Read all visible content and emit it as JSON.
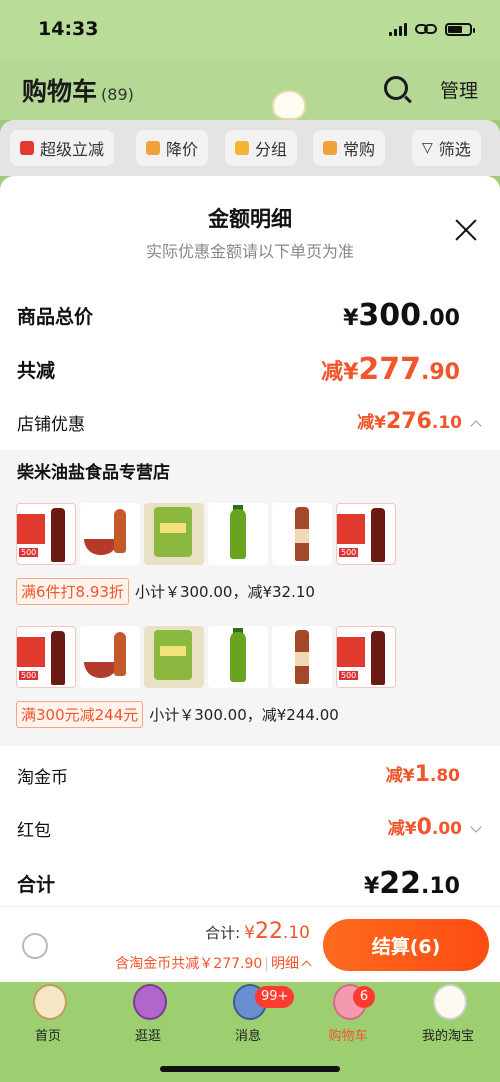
{
  "status": {
    "time": "14:33"
  },
  "header": {
    "title": "购物车",
    "count": "(89)",
    "manage": "管理"
  },
  "filters": [
    {
      "label": "超级立减",
      "icon": "arrow-down-icon"
    },
    {
      "label": "降价",
      "icon": "price-drop-icon"
    },
    {
      "label": "分组",
      "icon": "folder-icon"
    },
    {
      "label": "常购",
      "icon": "cart-icon"
    },
    {
      "label": "筛选",
      "icon": "filter-icon"
    }
  ],
  "sheet": {
    "title": "金额明细",
    "subtitle": "实际优惠金额请以下单页为准",
    "total_label": "商品总价",
    "total_currency": "¥",
    "total_int": "300",
    "total_dec": ".00",
    "discount_label": "共减",
    "discount_prefix": "减¥",
    "discount_int": "277",
    "discount_dec": ".90",
    "shop_label": "店铺优惠",
    "shop_prefix": "减¥",
    "shop_int": "276",
    "shop_dec": ".10",
    "store_name": "柴米油盐食品专营店",
    "promos": [
      {
        "tag": "满6件打8.93折",
        "text": "小计￥300.00，减¥32.10"
      },
      {
        "tag": "满300元减244元",
        "text": "小计￥300.00，减¥244.00"
      }
    ],
    "coin_label": "淘金币",
    "coin_prefix": "减¥",
    "coin_int": "1",
    "coin_dec": ".80",
    "redpack_label": "红包",
    "redpack_prefix": "减¥",
    "redpack_int": "0",
    "redpack_dec": ".00",
    "sum_label": "合计",
    "sum_currency": "¥",
    "sum_int": "22",
    "sum_dec": ".10"
  },
  "checkout": {
    "total_label": "合计:",
    "currency": "¥",
    "total_int": "22",
    "total_dec": ".10",
    "saved_text": "含淘金币共减￥277.90",
    "detail_label": "明细",
    "pay_button": "结算(6)"
  },
  "tabbar": [
    {
      "label": "首页"
    },
    {
      "label": "逛逛"
    },
    {
      "label": "消息",
      "badge": "99+"
    },
    {
      "label": "购物车",
      "badge": "6"
    },
    {
      "label": "我的淘宝"
    }
  ],
  "colors": {
    "accent": "#f1552c",
    "button": "#fe5a17",
    "green_bg": "#9dcf70"
  }
}
